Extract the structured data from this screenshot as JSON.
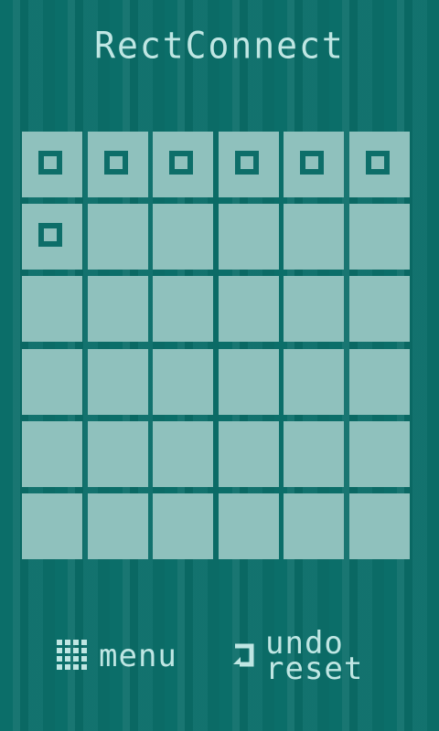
{
  "app": {
    "title": "RectConnect"
  },
  "board": {
    "rows": 6,
    "cols": 6,
    "markers": [
      [
        1,
        1,
        1,
        1,
        1,
        1
      ],
      [
        1,
        0,
        0,
        0,
        0,
        0
      ],
      [
        0,
        0,
        0,
        0,
        0,
        0
      ],
      [
        0,
        0,
        0,
        0,
        0,
        0
      ],
      [
        0,
        0,
        0,
        0,
        0,
        0
      ],
      [
        0,
        0,
        0,
        0,
        0,
        0
      ]
    ]
  },
  "controls": {
    "menu_label": "menu",
    "undo_label": "undo",
    "reset_label": "reset"
  },
  "colors": {
    "background": "#0b6e69",
    "cell": "#8fc1bd",
    "marker": "#0d6e69",
    "text": "#bfe6e3"
  }
}
